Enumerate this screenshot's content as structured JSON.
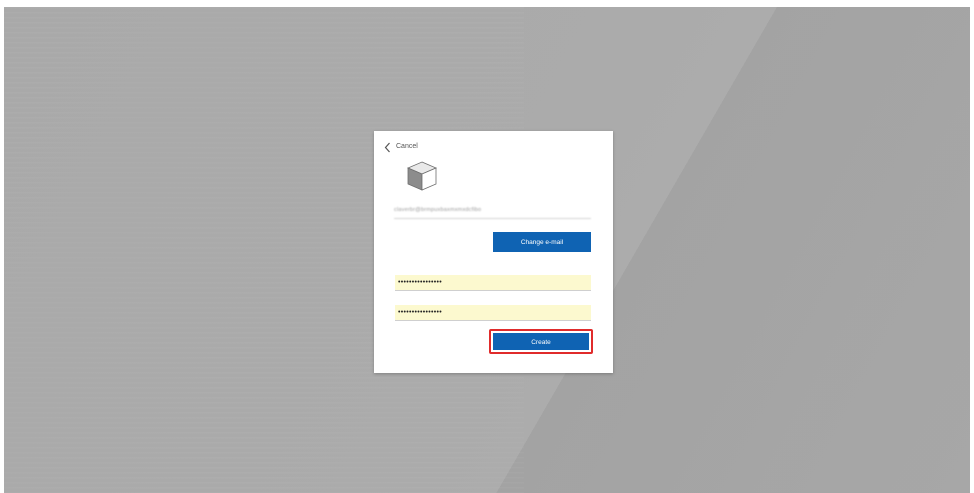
{
  "dialog": {
    "back_label": "Cancel",
    "email_value": "claverbr@brmpuxbaxmxmxdcfibo",
    "change_email_label": "Change e-mail",
    "password_value": "••••••••••••••••",
    "confirm_password_value": "••••••••••••••••",
    "create_label": "Create"
  },
  "icons": {
    "back": "chevron-left-icon",
    "product": "cube-icon"
  },
  "colors": {
    "primary_button": "#0f63b3",
    "autofill_background": "#fcf9cf",
    "focus_outline": "#e02b2b",
    "backdrop": "#ababab"
  }
}
